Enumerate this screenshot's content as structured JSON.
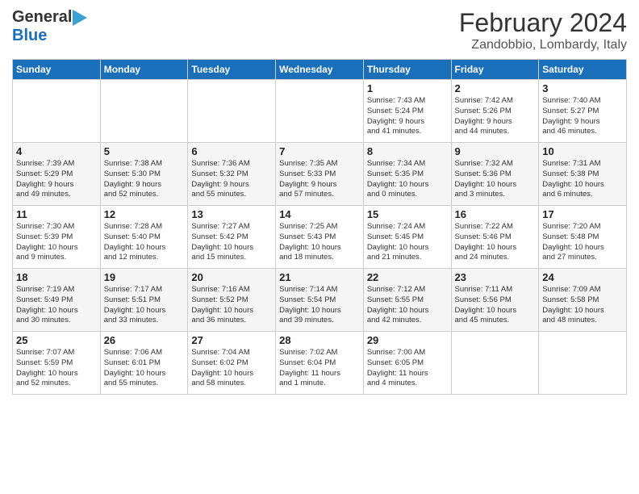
{
  "header": {
    "logo_general": "General",
    "logo_blue": "Blue",
    "month": "February 2024",
    "location": "Zandobbio, Lombardy, Italy"
  },
  "weekdays": [
    "Sunday",
    "Monday",
    "Tuesday",
    "Wednesday",
    "Thursday",
    "Friday",
    "Saturday"
  ],
  "weeks": [
    [
      {
        "day": "",
        "info": ""
      },
      {
        "day": "",
        "info": ""
      },
      {
        "day": "",
        "info": ""
      },
      {
        "day": "",
        "info": ""
      },
      {
        "day": "1",
        "info": "Sunrise: 7:43 AM\nSunset: 5:24 PM\nDaylight: 9 hours\nand 41 minutes."
      },
      {
        "day": "2",
        "info": "Sunrise: 7:42 AM\nSunset: 5:26 PM\nDaylight: 9 hours\nand 44 minutes."
      },
      {
        "day": "3",
        "info": "Sunrise: 7:40 AM\nSunset: 5:27 PM\nDaylight: 9 hours\nand 46 minutes."
      }
    ],
    [
      {
        "day": "4",
        "info": "Sunrise: 7:39 AM\nSunset: 5:29 PM\nDaylight: 9 hours\nand 49 minutes."
      },
      {
        "day": "5",
        "info": "Sunrise: 7:38 AM\nSunset: 5:30 PM\nDaylight: 9 hours\nand 52 minutes."
      },
      {
        "day": "6",
        "info": "Sunrise: 7:36 AM\nSunset: 5:32 PM\nDaylight: 9 hours\nand 55 minutes."
      },
      {
        "day": "7",
        "info": "Sunrise: 7:35 AM\nSunset: 5:33 PM\nDaylight: 9 hours\nand 57 minutes."
      },
      {
        "day": "8",
        "info": "Sunrise: 7:34 AM\nSunset: 5:35 PM\nDaylight: 10 hours\nand 0 minutes."
      },
      {
        "day": "9",
        "info": "Sunrise: 7:32 AM\nSunset: 5:36 PM\nDaylight: 10 hours\nand 3 minutes."
      },
      {
        "day": "10",
        "info": "Sunrise: 7:31 AM\nSunset: 5:38 PM\nDaylight: 10 hours\nand 6 minutes."
      }
    ],
    [
      {
        "day": "11",
        "info": "Sunrise: 7:30 AM\nSunset: 5:39 PM\nDaylight: 10 hours\nand 9 minutes."
      },
      {
        "day": "12",
        "info": "Sunrise: 7:28 AM\nSunset: 5:40 PM\nDaylight: 10 hours\nand 12 minutes."
      },
      {
        "day": "13",
        "info": "Sunrise: 7:27 AM\nSunset: 5:42 PM\nDaylight: 10 hours\nand 15 minutes."
      },
      {
        "day": "14",
        "info": "Sunrise: 7:25 AM\nSunset: 5:43 PM\nDaylight: 10 hours\nand 18 minutes."
      },
      {
        "day": "15",
        "info": "Sunrise: 7:24 AM\nSunset: 5:45 PM\nDaylight: 10 hours\nand 21 minutes."
      },
      {
        "day": "16",
        "info": "Sunrise: 7:22 AM\nSunset: 5:46 PM\nDaylight: 10 hours\nand 24 minutes."
      },
      {
        "day": "17",
        "info": "Sunrise: 7:20 AM\nSunset: 5:48 PM\nDaylight: 10 hours\nand 27 minutes."
      }
    ],
    [
      {
        "day": "18",
        "info": "Sunrise: 7:19 AM\nSunset: 5:49 PM\nDaylight: 10 hours\nand 30 minutes."
      },
      {
        "day": "19",
        "info": "Sunrise: 7:17 AM\nSunset: 5:51 PM\nDaylight: 10 hours\nand 33 minutes."
      },
      {
        "day": "20",
        "info": "Sunrise: 7:16 AM\nSunset: 5:52 PM\nDaylight: 10 hours\nand 36 minutes."
      },
      {
        "day": "21",
        "info": "Sunrise: 7:14 AM\nSunset: 5:54 PM\nDaylight: 10 hours\nand 39 minutes."
      },
      {
        "day": "22",
        "info": "Sunrise: 7:12 AM\nSunset: 5:55 PM\nDaylight: 10 hours\nand 42 minutes."
      },
      {
        "day": "23",
        "info": "Sunrise: 7:11 AM\nSunset: 5:56 PM\nDaylight: 10 hours\nand 45 minutes."
      },
      {
        "day": "24",
        "info": "Sunrise: 7:09 AM\nSunset: 5:58 PM\nDaylight: 10 hours\nand 48 minutes."
      }
    ],
    [
      {
        "day": "25",
        "info": "Sunrise: 7:07 AM\nSunset: 5:59 PM\nDaylight: 10 hours\nand 52 minutes."
      },
      {
        "day": "26",
        "info": "Sunrise: 7:06 AM\nSunset: 6:01 PM\nDaylight: 10 hours\nand 55 minutes."
      },
      {
        "day": "27",
        "info": "Sunrise: 7:04 AM\nSunset: 6:02 PM\nDaylight: 10 hours\nand 58 minutes."
      },
      {
        "day": "28",
        "info": "Sunrise: 7:02 AM\nSunset: 6:04 PM\nDaylight: 11 hours\nand 1 minute."
      },
      {
        "day": "29",
        "info": "Sunrise: 7:00 AM\nSunset: 6:05 PM\nDaylight: 11 hours\nand 4 minutes."
      },
      {
        "day": "",
        "info": ""
      },
      {
        "day": "",
        "info": ""
      }
    ]
  ]
}
